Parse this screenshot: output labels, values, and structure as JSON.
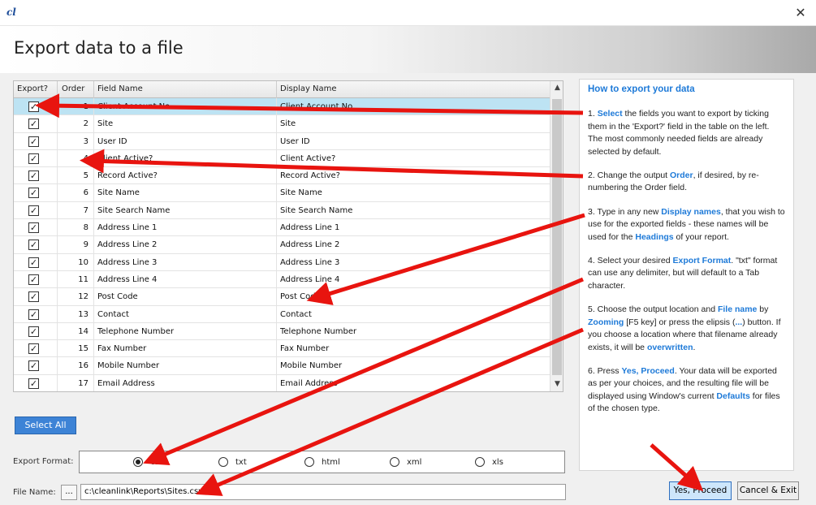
{
  "window": {
    "logo": "cl",
    "close_glyph": "✕"
  },
  "header": {
    "title": "Export data to a file"
  },
  "grid": {
    "columns": [
      "Export?",
      "Order",
      "Field Name",
      "Display Name"
    ],
    "rows": [
      {
        "checked": true,
        "order": "1",
        "field": "Client Account No",
        "display": "Client Account No",
        "selected": true
      },
      {
        "checked": true,
        "order": "2",
        "field": "Site",
        "display": "Site"
      },
      {
        "checked": true,
        "order": "3",
        "field": "User ID",
        "display": "User ID"
      },
      {
        "checked": true,
        "order": "4",
        "field": "Client Active?",
        "display": "Client Active?"
      },
      {
        "checked": true,
        "order": "5",
        "field": "Record Active?",
        "display": "Record Active?"
      },
      {
        "checked": true,
        "order": "6",
        "field": "Site Name",
        "display": "Site Name"
      },
      {
        "checked": true,
        "order": "7",
        "field": "Site Search Name",
        "display": "Site Search Name"
      },
      {
        "checked": true,
        "order": "8",
        "field": "Address Line 1",
        "display": "Address Line 1"
      },
      {
        "checked": true,
        "order": "9",
        "field": "Address Line 2",
        "display": "Address Line 2"
      },
      {
        "checked": true,
        "order": "10",
        "field": "Address Line 3",
        "display": "Address Line 3"
      },
      {
        "checked": true,
        "order": "11",
        "field": "Address Line 4",
        "display": "Address Line 4"
      },
      {
        "checked": true,
        "order": "12",
        "field": "Post Code",
        "display": "Post Code"
      },
      {
        "checked": true,
        "order": "13",
        "field": "Contact",
        "display": "Contact"
      },
      {
        "checked": true,
        "order": "14",
        "field": "Telephone Number",
        "display": "Telephone Number"
      },
      {
        "checked": true,
        "order": "15",
        "field": "Fax Number",
        "display": "Fax Number"
      },
      {
        "checked": true,
        "order": "16",
        "field": "Mobile Number",
        "display": "Mobile Number"
      },
      {
        "checked": true,
        "order": "17",
        "field": "Email Address",
        "display": "Email Address"
      }
    ],
    "scroll_up": "▲",
    "scroll_down": "▼"
  },
  "select_all_label": "Select All",
  "export_format": {
    "label": "Export Format:",
    "selected": "csv",
    "options": [
      "csv",
      "txt",
      "html",
      "xml",
      "xls"
    ]
  },
  "file_name": {
    "label": "File Name:",
    "ellipsis": "...",
    "value": "c:\\cleanlink\\Reports\\Sites.csv"
  },
  "help": {
    "title": "How to export your data",
    "steps": [
      [
        {
          "t": "1. "
        },
        {
          "t": "Select",
          "h": true
        },
        {
          "t": " the fields you want to export by ticking them in the 'Export?' field in the table on the left. The most commonly needed fields are already selected by default."
        }
      ],
      [
        {
          "t": "2. Change the output "
        },
        {
          "t": "Order",
          "h": true
        },
        {
          "t": ", if desired, by re-numbering the Order field."
        }
      ],
      [
        {
          "t": "3. Type in any new "
        },
        {
          "t": "Display names",
          "h": true
        },
        {
          "t": ", that you wish to use for the exported fields - these names will be used for the "
        },
        {
          "t": "Headings",
          "h": true
        },
        {
          "t": " of your report."
        }
      ],
      [
        {
          "t": "4. Select your desired "
        },
        {
          "t": "Export Format",
          "h": true
        },
        {
          "t": ". \"txt\" format can use any delimiter, but will default to a Tab character."
        }
      ],
      [
        {
          "t": "5. Choose the output location and "
        },
        {
          "t": "File name",
          "h": true
        },
        {
          "t": " by "
        },
        {
          "t": "Zooming",
          "h": true
        },
        {
          "t": " [F5 key] or press the elipsis ("
        },
        {
          "t": "...",
          "h": true
        },
        {
          "t": ") button. If you choose a location where that filename already exists, it will be "
        },
        {
          "t": "overwritten",
          "h": true
        },
        {
          "t": "."
        }
      ],
      [
        {
          "t": "6. Press "
        },
        {
          "t": "Yes, Proceed",
          "h": true
        },
        {
          "t": ". Your data will be exported as per your choices, and the resulting file will be displayed using Window's current "
        },
        {
          "t": "Defaults",
          "h": true
        },
        {
          "t": " for files of the chosen type."
        }
      ]
    ]
  },
  "buttons": {
    "proceed": "Yes, Proceed",
    "cancel": "Cancel & Exit"
  },
  "colors": {
    "accent": "#1e7ad8",
    "arrow": "#e8140f",
    "selected_row": "#bde3f3"
  }
}
